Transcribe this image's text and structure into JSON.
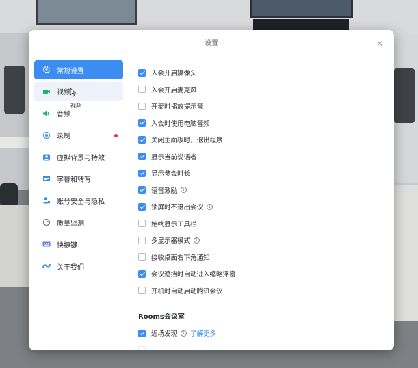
{
  "dialog": {
    "title": "设置",
    "close_icon": "close-icon"
  },
  "sidebar": {
    "items": [
      {
        "label": "常规设置",
        "icon": "gear-icon",
        "active": true
      },
      {
        "label": "视频",
        "icon": "video-camera-icon"
      },
      {
        "label": "音频",
        "icon": "speaker-icon"
      },
      {
        "label": "录制",
        "icon": "record-icon",
        "badge": "red-dot"
      },
      {
        "label": "虚拟背景与特效",
        "icon": "virtual-background-icon"
      },
      {
        "label": "字幕和转写",
        "icon": "subtitle-icon"
      },
      {
        "label": "账号安全与隐私",
        "icon": "account-security-icon"
      },
      {
        "label": "质量监测",
        "icon": "quality-monitor-icon"
      },
      {
        "label": "快捷键",
        "icon": "keyboard-icon"
      },
      {
        "label": "关于我们",
        "icon": "about-logo-icon"
      }
    ],
    "tooltip": "视频"
  },
  "general": {
    "options": [
      {
        "label": "入会开启摄像头",
        "checked": true
      },
      {
        "label": "入会开启麦克风",
        "checked": false
      },
      {
        "label": "开麦时播放提示音",
        "checked": false
      },
      {
        "label": "入会时使用电脑音频",
        "checked": true
      },
      {
        "label": "关闭主面板时，退出程序",
        "checked": true
      },
      {
        "label": "显示当前说话者",
        "checked": true
      },
      {
        "label": "显示参会时长",
        "checked": true
      },
      {
        "label": "语音激励",
        "checked": true,
        "info": true
      },
      {
        "label": "锁屏时不退出会议",
        "checked": true,
        "info": true
      },
      {
        "label": "始终显示工具栏",
        "checked": false
      },
      {
        "label": "多显示器模式",
        "checked": false,
        "info": true
      },
      {
        "label": "接收桌面右下角通知",
        "checked": false
      },
      {
        "label": "会议遮挡时自动进入缩略浮窗",
        "checked": true
      },
      {
        "label": "开机时自动启动腾讯会议",
        "checked": false
      }
    ]
  },
  "rooms": {
    "title": "Rooms会议室",
    "options": [
      {
        "label": "近场发现",
        "checked": true,
        "info": true,
        "link": "了解更多"
      }
    ]
  },
  "colors": {
    "accent": "#3b8df2",
    "badge": "#e5322d"
  }
}
